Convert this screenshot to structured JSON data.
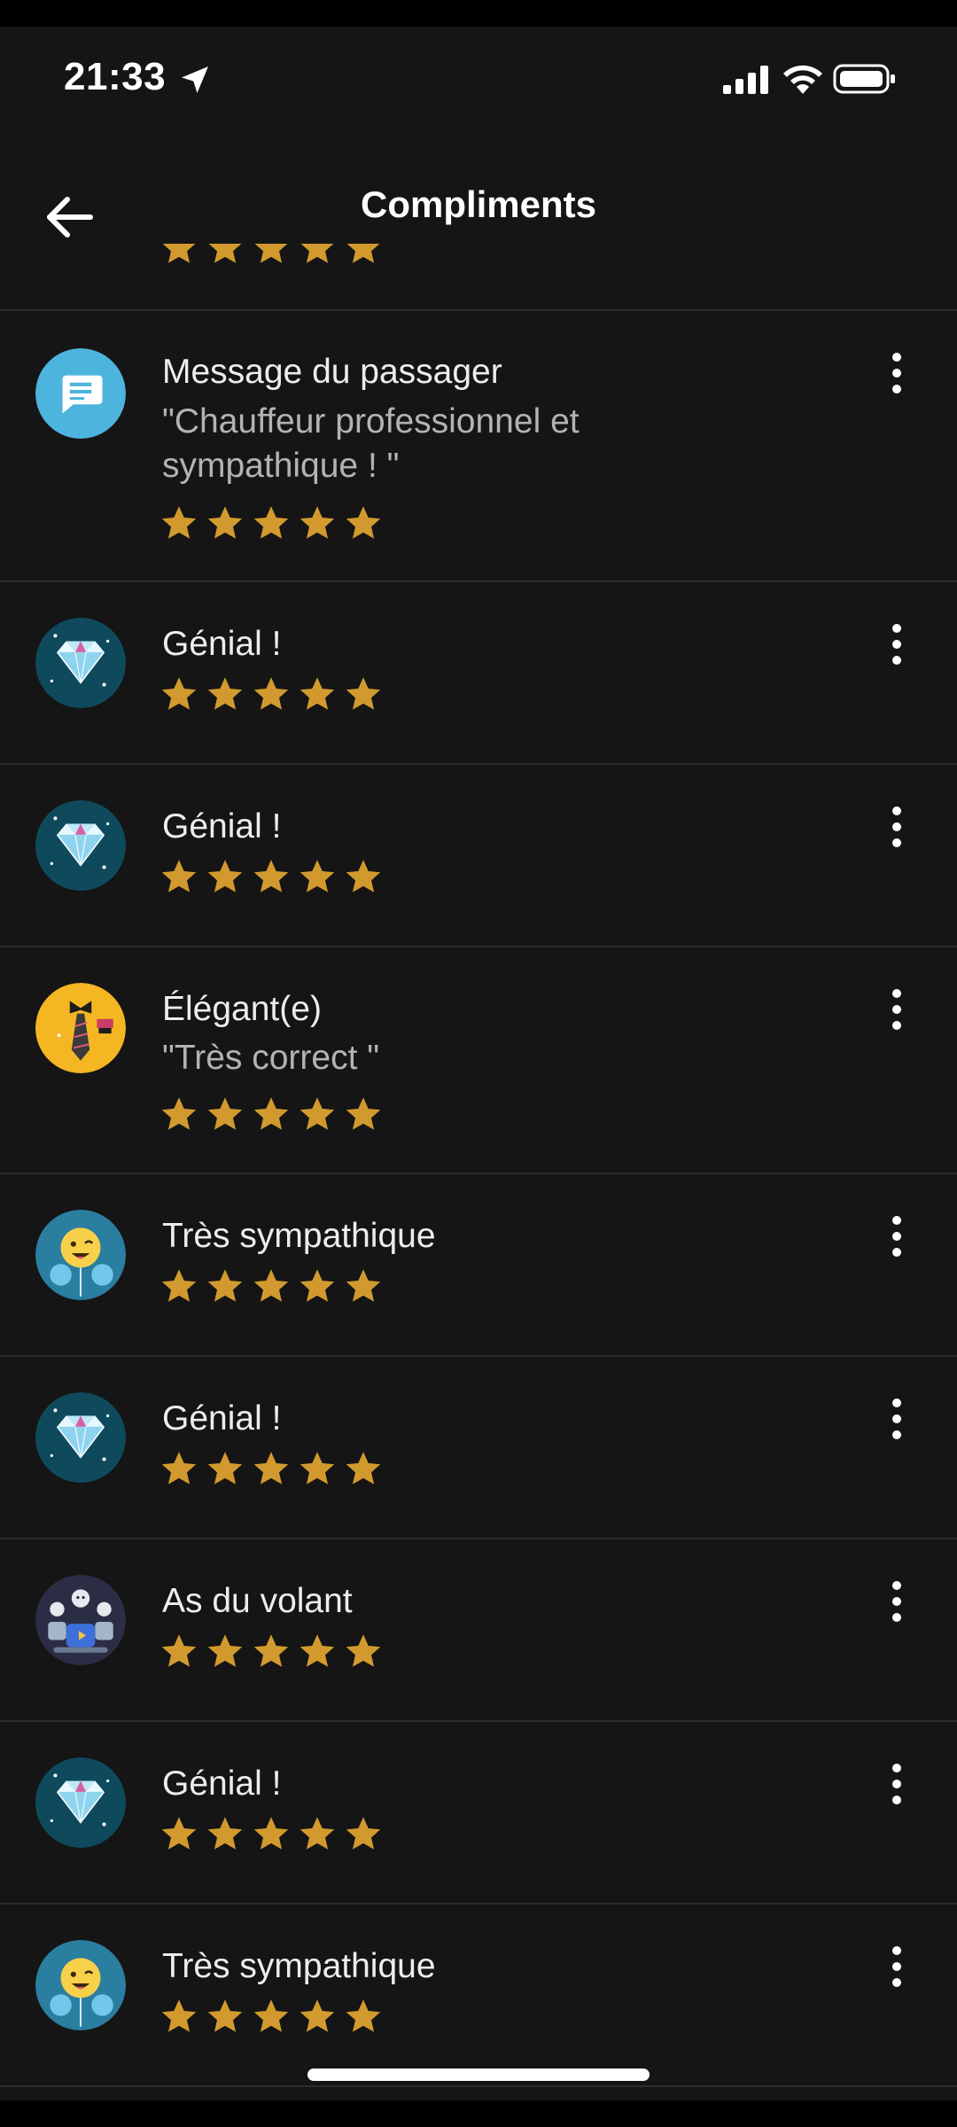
{
  "status_bar": {
    "time": "21:33",
    "icons": [
      "location-arrow-icon",
      "cellular-signal-icon",
      "wifi-icon",
      "battery-icon"
    ]
  },
  "header": {
    "title": "Compliments",
    "back_icon": "arrow-left-icon"
  },
  "colors": {
    "background": "#151515",
    "star": "#d29a2e",
    "divider": "#2c2c2c",
    "message_avatar": "#4db4de",
    "diamond_avatar": "#0f4a5c",
    "elegant_avatar": "#f5b623",
    "smile_avatar": "#2a7ea0",
    "driver_avatar": "#2b2d45"
  },
  "compliments": [
    {
      "type": "message",
      "title": "Message du passager",
      "quote": "\"Chauffeur professionnel et sympathique ! \"",
      "stars": 5
    },
    {
      "type": "diamond",
      "title": "Génial !",
      "stars": 5
    },
    {
      "type": "diamond",
      "title": "Génial !",
      "stars": 5
    },
    {
      "type": "elegant",
      "title": "Élégant(e)",
      "quote": "\"Très correct \"",
      "stars": 5
    },
    {
      "type": "smile",
      "title": "Très sympathique",
      "stars": 5
    },
    {
      "type": "diamond",
      "title": "Génial !",
      "stars": 5
    },
    {
      "type": "driver",
      "title": "As du volant",
      "stars": 5
    },
    {
      "type": "diamond",
      "title": "Génial !",
      "stars": 5
    },
    {
      "type": "smile",
      "title": "Très sympathique",
      "stars": 5
    }
  ]
}
